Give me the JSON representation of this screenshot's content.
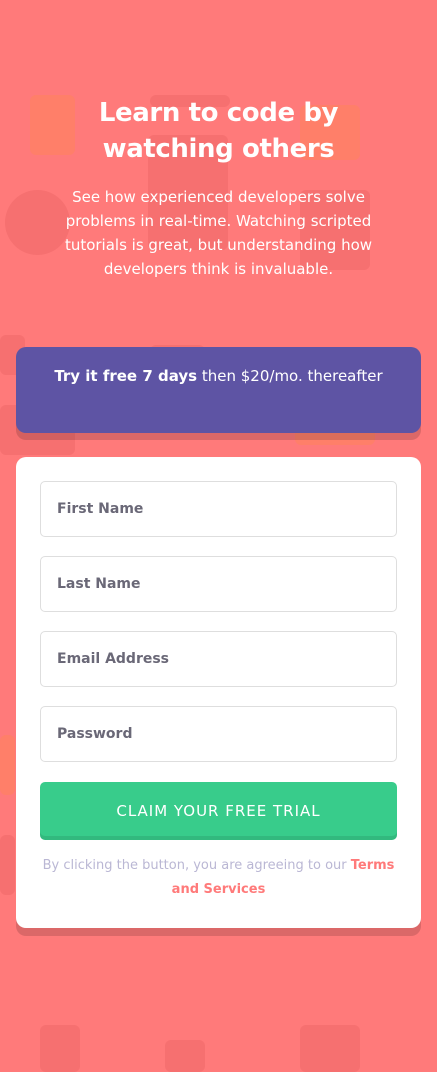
{
  "hero": {
    "title": "Learn to code by watching others",
    "description": "See how experienced developers solve problems in real-time. Watching scripted tutorials is great, but understanding how developers think is invaluable."
  },
  "offer": {
    "bold_text": "Try it free 7 days",
    "rest_text": " then $20/mo. thereafter"
  },
  "form": {
    "first_name_placeholder": "First Name",
    "last_name_placeholder": "Last Name",
    "email_placeholder": "Email Address",
    "password_placeholder": "Password",
    "submit_label": "CLAIM YOUR FREE TRIAL",
    "terms_prefix": "By clicking the button, you are agreeing to our ",
    "terms_link": "Terms and Services"
  },
  "colors": {
    "background": "#ff7a7a",
    "offer_background": "#5e54a4",
    "button": "#38cc8b",
    "terms_link": "#ff7a7a"
  }
}
